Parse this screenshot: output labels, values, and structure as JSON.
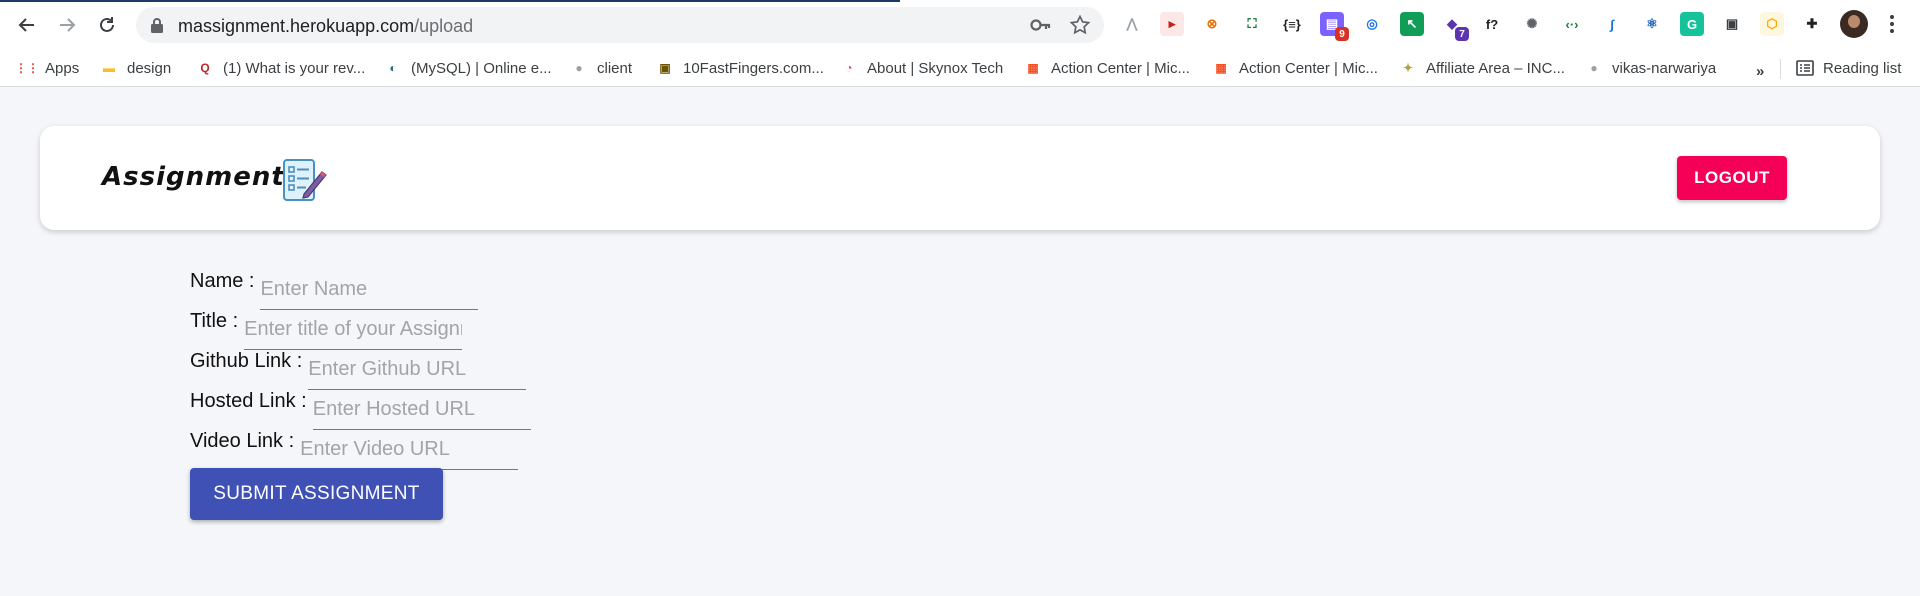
{
  "browser": {
    "url_host": "massignment.herokuapp.com",
    "url_path": "/upload",
    "extensions": [
      {
        "name": "extension-triangle-icon",
        "glyph": "⋀",
        "color": "#9aa0a6",
        "bg": "transparent",
        "badge": ""
      },
      {
        "name": "extension-video-icon",
        "glyph": "▸",
        "color": "#c5221f",
        "bg": "#fce8e6",
        "badge": ""
      },
      {
        "name": "extension-target-icon",
        "glyph": "⊗",
        "color": "#e8710a",
        "bg": "transparent",
        "badge": ""
      },
      {
        "name": "extension-screenshot-icon",
        "glyph": "⛶",
        "color": "#137333",
        "bg": "transparent",
        "badge": ""
      },
      {
        "name": "extension-json-icon",
        "glyph": "{≡}",
        "color": "#202124",
        "bg": "transparent",
        "badge": ""
      },
      {
        "name": "extension-chat-icon",
        "glyph": "▤",
        "color": "#ffffff",
        "bg": "#7b61ff",
        "badge": "9",
        "badgeColor": "#d93025"
      },
      {
        "name": "extension-glasses-icon",
        "glyph": "◎",
        "color": "#1a73e8",
        "bg": "transparent",
        "badge": ""
      },
      {
        "name": "extension-cursor-icon",
        "glyph": "↖",
        "color": "#ffffff",
        "bg": "#0f9d58",
        "badge": ""
      },
      {
        "name": "extension-graduation-icon",
        "glyph": "◆",
        "color": "#5e35b1",
        "bg": "transparent",
        "badge": "7",
        "badgeColor": "#5e35b1"
      },
      {
        "name": "extension-font-icon",
        "glyph": "f?",
        "color": "#202124",
        "bg": "transparent",
        "badge": ""
      },
      {
        "name": "extension-gear-icon",
        "glyph": "✺",
        "color": "#5f6368",
        "bg": "transparent",
        "badge": ""
      },
      {
        "name": "extension-code-icon",
        "glyph": "‹·›",
        "color": "#188038",
        "bg": "transparent",
        "badge": ""
      },
      {
        "name": "extension-feather-icon",
        "glyph": "∫",
        "color": "#1a73e8",
        "bg": "transparent",
        "badge": ""
      },
      {
        "name": "extension-react-icon",
        "glyph": "⚛",
        "color": "#1a5fb4",
        "bg": "transparent",
        "badge": ""
      },
      {
        "name": "extension-grammarly-icon",
        "glyph": "G",
        "color": "#ffffff",
        "bg": "#15c39a",
        "badge": ""
      },
      {
        "name": "extension-card-icon",
        "glyph": "▣",
        "color": "#3c4043",
        "bg": "transparent",
        "badge": ""
      },
      {
        "name": "extension-hexagon-icon",
        "glyph": "⬡",
        "color": "#f9ab00",
        "bg": "#fef7e0",
        "badge": ""
      },
      {
        "name": "extensions-puzzle-icon",
        "glyph": "✚",
        "color": "#202124",
        "bg": "transparent",
        "badge": ""
      }
    ],
    "bookmarks": [
      {
        "name": "bookmark-apps",
        "label": "Apps",
        "icon": "apps-grid-icon",
        "glyph": "⋮⋮",
        "color": "#ea4335"
      },
      {
        "name": "bookmark-design",
        "label": "design",
        "icon": "folder-icon",
        "glyph": "▬",
        "color": "#f6c026"
      },
      {
        "name": "bookmark-quora",
        "label": "(1) What is your rev...",
        "icon": "quora-icon",
        "glyph": "Q",
        "color": "#b92b27"
      },
      {
        "name": "bookmark-mysql",
        "label": "(MySQL) | Online e...",
        "icon": "mysql-icon",
        "glyph": "◐",
        "color": "#1f6f8b"
      },
      {
        "name": "bookmark-client",
        "label": "client",
        "icon": "github-icon",
        "glyph": "●",
        "color": "#9aa0a6"
      },
      {
        "name": "bookmark-10fastfingers",
        "label": "10FastFingers.com...",
        "icon": "fastfingers-icon",
        "glyph": "▣",
        "color": "#6b5300"
      },
      {
        "name": "bookmark-skynox",
        "label": "About | Skynox Tech",
        "icon": "skynox-icon",
        "glyph": "◔",
        "color": "#e8457c"
      },
      {
        "name": "bookmark-action-center-1",
        "label": "Action Center | Mic...",
        "icon": "microsoft-icon",
        "glyph": "▦",
        "color": "#f25022"
      },
      {
        "name": "bookmark-action-center-2",
        "label": "Action Center | Mic...",
        "icon": "microsoft-icon",
        "glyph": "▦",
        "color": "#f25022"
      },
      {
        "name": "bookmark-affiliate",
        "label": "Affiliate Area – INC...",
        "icon": "lightbulb-icon",
        "glyph": "✦",
        "color": "#b0a040"
      },
      {
        "name": "bookmark-vikas",
        "label": "vikas-narwariya",
        "icon": "github-icon",
        "glyph": "●",
        "color": "#9aa0a6"
      }
    ],
    "more_label": "»",
    "reading_list_label": "Reading list"
  },
  "header": {
    "logo_text": "Assignment",
    "logout_label": "LOGOUT",
    "logout_color": "#f50057"
  },
  "form": {
    "fields": [
      {
        "name": "name",
        "label": "Name :",
        "placeholder": "Enter Name",
        "value": ""
      },
      {
        "name": "title",
        "label": "Title :",
        "placeholder": "Enter title of your Assignment",
        "value": ""
      },
      {
        "name": "github",
        "label": "Github Link :",
        "placeholder": "Enter Github URL",
        "value": ""
      },
      {
        "name": "hosted",
        "label": "Hosted Link :",
        "placeholder": "Enter Hosted URL",
        "value": ""
      },
      {
        "name": "video",
        "label": "Video Link :",
        "placeholder": "Enter Video URL",
        "value": ""
      }
    ],
    "submit_label": "SUBMIT ASSIGNMENT",
    "submit_color": "#3f51b5"
  }
}
